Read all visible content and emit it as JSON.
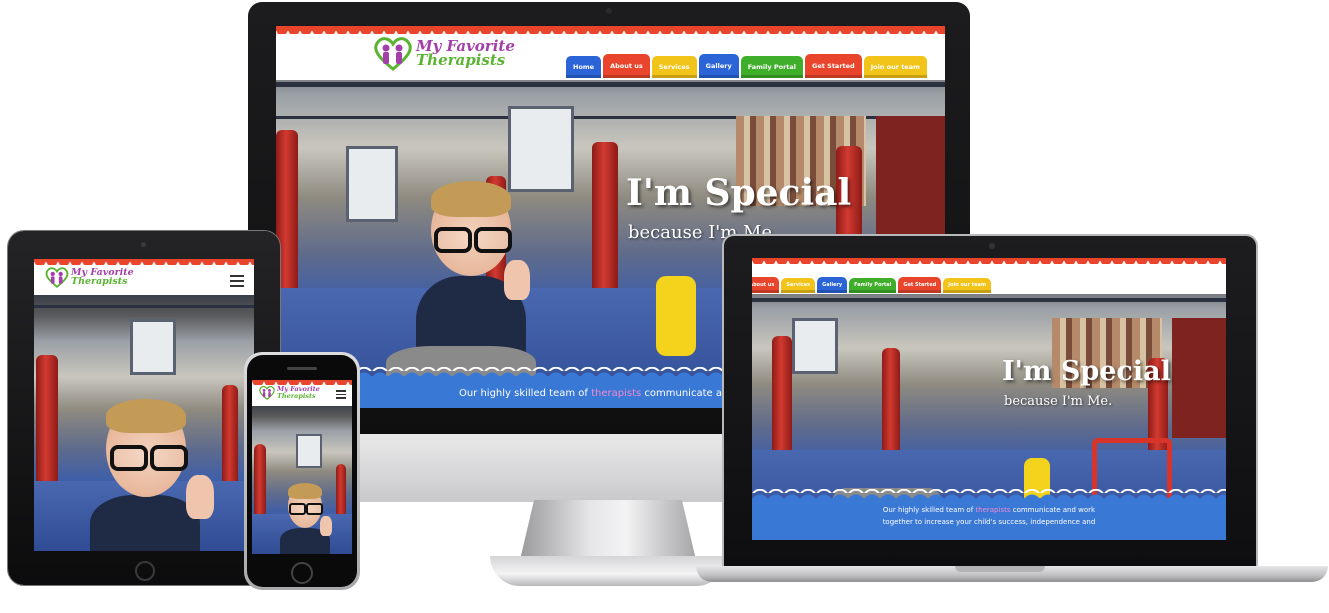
{
  "site": {
    "logo_line1": "My Favorite",
    "logo_line2": "Therapists",
    "nav": [
      {
        "label": "Home",
        "color": "#2a64d6"
      },
      {
        "label": "About us",
        "color": "#e8452c"
      },
      {
        "label": "Services",
        "color": "#f2c318"
      },
      {
        "label": "Gallery",
        "color": "#2a64d6"
      },
      {
        "label": "Family Portal",
        "color": "#3fae2a"
      },
      {
        "label": "Get Started",
        "color": "#e8452c"
      },
      {
        "label": "Join our team",
        "color": "#f2c318"
      }
    ],
    "hero_title": "I'm Special",
    "hero_subtitle": "because I'm Me",
    "caption_pre": "Our highly skilled team of",
    "caption_highlight": "therapists",
    "caption_post": "communicate and work",
    "caption_line2": "together to increase your child's success, independence and"
  },
  "devices": {
    "laptop_hero_subtitle": "because I'm Me."
  },
  "colors": {
    "accent_red": "#e8452c",
    "accent_blue": "#3a78d6",
    "logo_purple": "#a23fa9",
    "logo_green": "#5bb332",
    "highlight_pink": "#f08ad0"
  },
  "icons": {
    "menu": "hamburger-menu-icon",
    "logo": "family-heart-logo-icon"
  }
}
